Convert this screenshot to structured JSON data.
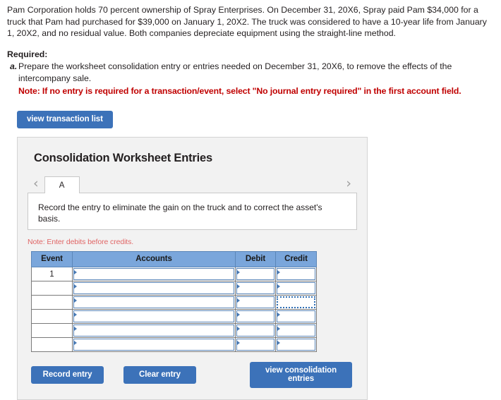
{
  "problem": {
    "paragraph": "Pam Corporation holds 70 percent ownership of Spray Enterprises. On December 31, 20X6, Spray paid Pam $34,000 for a truck that Pam had purchased for $39,000 on January 1, 20X2. The truck was considered to have a 10-year life from January 1, 20X2, and no residual value. Both companies depreciate equipment using the straight-line method."
  },
  "required": {
    "label": "Required:",
    "items": [
      {
        "marker": "a.",
        "text": "Prepare the worksheet consolidation entry or entries needed on December 31, 20X6, to remove the effects of the intercompany sale.",
        "note": "Note: If no entry is required for a transaction/event, select \"No journal entry required\" in the first account field."
      }
    ]
  },
  "toolbar": {
    "view_transaction_list_label": "view transaction list"
  },
  "panel": {
    "title": "Consolidation Worksheet Entries",
    "tabs": {
      "prev_icon": "chevron-left-icon",
      "next_icon": "chevron-right-icon",
      "items": [
        {
          "label": "A",
          "selected": true
        }
      ]
    },
    "instruction": "Record the entry to eliminate the gain on the truck and to correct the asset's basis.",
    "debit_note": "Note: Enter debits before credits.",
    "table": {
      "columns": [
        "Event",
        "Accounts",
        "Debit",
        "Credit"
      ],
      "rows": [
        {
          "event": "1",
          "account": "",
          "debit": "",
          "credit": "",
          "credit_focused": false
        },
        {
          "event": "",
          "account": "",
          "debit": "",
          "credit": "",
          "credit_focused": false
        },
        {
          "event": "",
          "account": "",
          "debit": "",
          "credit": "",
          "credit_focused": true
        },
        {
          "event": "",
          "account": "",
          "debit": "",
          "credit": "",
          "credit_focused": false
        },
        {
          "event": "",
          "account": "",
          "debit": "",
          "credit": "",
          "credit_focused": false
        },
        {
          "event": "",
          "account": "",
          "debit": "",
          "credit": "",
          "credit_focused": false
        }
      ]
    },
    "actions": {
      "record_label": "Record entry",
      "clear_label": "Clear entry",
      "view_label": "view consolidation entries"
    }
  },
  "colors": {
    "button_blue": "#3c72b9",
    "table_header_blue": "#7aa6db",
    "note_red": "#c00000",
    "debit_note_red": "#e06666",
    "panel_bg": "#f2f2f2"
  }
}
